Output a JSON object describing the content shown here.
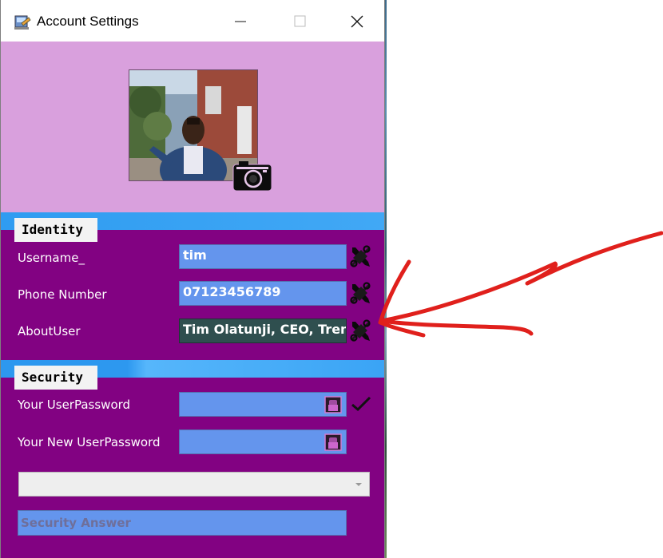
{
  "window": {
    "title": "Account Settings"
  },
  "identity": {
    "section_title": "Identity",
    "username": {
      "label": "Username_",
      "value": "tim"
    },
    "phone": {
      "label": "Phone Number",
      "value": "07123456789"
    },
    "about": {
      "label": "AboutUser",
      "value": "Tim Olatunji, CEO, Trents /"
    }
  },
  "security": {
    "section_title": "Security",
    "password": {
      "label": "Your UserPassword",
      "value": ""
    },
    "new_password": {
      "label": "Your New UserPassword",
      "value": ""
    },
    "question_select": {
      "value": ""
    },
    "answer": {
      "placeholder": "Security Answer"
    }
  },
  "colors": {
    "window_bg": "#820282",
    "photo_bg": "#d9a0dd",
    "field_bg": "#6495ed",
    "field_dark_bg": "#2f4f4f",
    "band": "#2f9cf1",
    "annotation_arrow": "#e0201c"
  },
  "icons": [
    "app-icon",
    "minimize-icon",
    "maximize-icon",
    "close-icon",
    "camera-icon",
    "tools-icon",
    "password-reveal-icon",
    "checkmark-icon",
    "chevron-down-icon"
  ]
}
